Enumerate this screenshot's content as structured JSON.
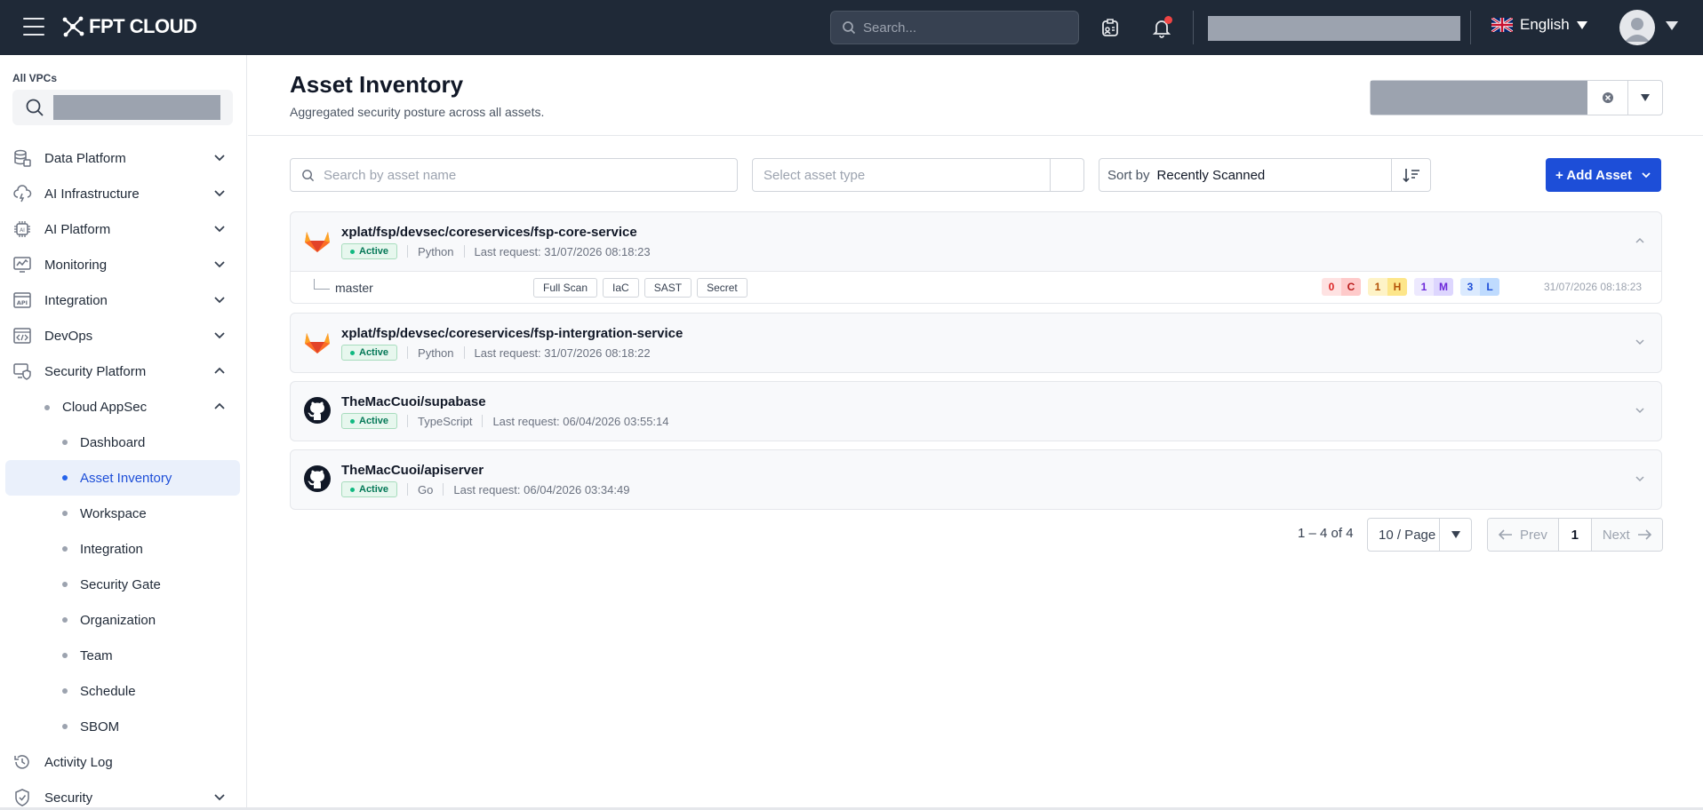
{
  "topbar": {
    "logo_text": "FPT CLOUD",
    "search_placeholder": "Search...",
    "language": "English",
    "colors": {
      "bg": "#1f2937",
      "notification_dot": "#ef4444"
    }
  },
  "sidebar": {
    "vpc_label": "All VPCs",
    "items": [
      {
        "label": "Data Platform",
        "icon": "database-icon",
        "expanded": false
      },
      {
        "label": "AI Infrastructure",
        "icon": "cloud-bolt-icon",
        "expanded": false
      },
      {
        "label": "AI Platform",
        "icon": "ai-chip-icon",
        "expanded": false
      },
      {
        "label": "Monitoring",
        "icon": "monitor-chart-icon",
        "expanded": false
      },
      {
        "label": "Integration",
        "icon": "api-icon",
        "expanded": false
      },
      {
        "label": "DevOps",
        "icon": "code-window-icon",
        "expanded": false
      },
      {
        "label": "Security Platform",
        "icon": "shield-monitor-icon",
        "expanded": true
      },
      {
        "label": "Cloud AppSec",
        "expanded": true
      },
      {
        "label": "Dashboard"
      },
      {
        "label": "Asset Inventory",
        "active": true
      },
      {
        "label": "Workspace"
      },
      {
        "label": "Integration"
      },
      {
        "label": "Security Gate"
      },
      {
        "label": "Organization"
      },
      {
        "label": "Team"
      },
      {
        "label": "Schedule"
      },
      {
        "label": "SBOM"
      },
      {
        "label": "Activity Log",
        "icon": "history-icon"
      },
      {
        "label": "Security",
        "icon": "shield-check-icon",
        "expanded": false
      }
    ],
    "active_color": "#1d4ed8"
  },
  "main": {
    "title": "Asset Inventory",
    "subtitle": "Aggregated security posture across all assets.",
    "filters": {
      "search_placeholder": "Search by asset name",
      "type_placeholder": "Select asset type",
      "sort_label": "Sort by",
      "sort_value": "Recently Scanned",
      "add_label": "+ Add Asset"
    },
    "assets": [
      {
        "name": "xplat/fsp/devsec/coreservices/fsp-core-service",
        "source": "gitlab",
        "status": "Active",
        "language": "Python",
        "last_request": "Last request: 31/07/2026 08:18:23",
        "expanded": true,
        "branch": {
          "name": "master",
          "tags": [
            "Full Scan",
            "IaC",
            "SAST",
            "Secret"
          ],
          "severity": {
            "critical": {
              "count": "0",
              "letter": "C"
            },
            "high": {
              "count": "1",
              "letter": "H"
            },
            "medium": {
              "count": "1",
              "letter": "M"
            },
            "low": {
              "count": "3",
              "letter": "L"
            }
          },
          "time": "31/07/2026 08:18:23"
        }
      },
      {
        "name": "xplat/fsp/devsec/coreservices/fsp-intergration-service",
        "source": "gitlab",
        "status": "Active",
        "language": "Python",
        "last_request": "Last request: 31/07/2026 08:18:22"
      },
      {
        "name": "TheMacCuoi/supabase",
        "source": "github",
        "status": "Active",
        "language": "TypeScript",
        "last_request": "Last request: 06/04/2026 03:55:14"
      },
      {
        "name": "TheMacCuoi/apiserver",
        "source": "github",
        "status": "Active",
        "language": "Go",
        "last_request": "Last request: 06/04/2026 03:34:49"
      }
    ],
    "pagination": {
      "info": "1 – 4 of 4",
      "per_page": "10 / Page",
      "prev": "Prev",
      "page": "1",
      "next": "Next"
    },
    "colors": {
      "primary": "#1d4ed8",
      "active_badge": "#047857"
    }
  }
}
